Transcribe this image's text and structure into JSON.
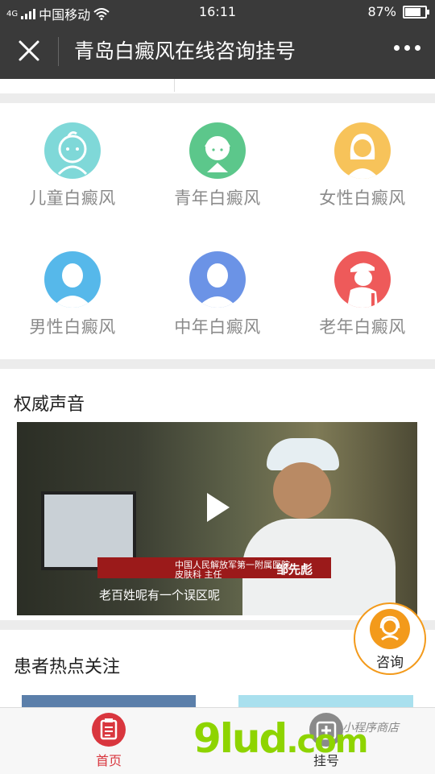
{
  "status_bar": {
    "carrier": "中国移动",
    "network": "4G",
    "time": "16:11",
    "battery_percent_text": "87%",
    "battery_level": 0.87
  },
  "title_bar": {
    "title": "青岛白癜风在线咨询挂号",
    "close_icon": "close-icon",
    "more_icon": "more-icon"
  },
  "categories": [
    {
      "label": "儿童白癜风",
      "icon": "child-icon",
      "color": "#7fd8d8"
    },
    {
      "label": "青年白癜风",
      "icon": "youth-icon",
      "color": "#5cc78b"
    },
    {
      "label": "女性白癜风",
      "icon": "woman-icon",
      "color": "#f7c35a"
    },
    {
      "label": "男性白癜风",
      "icon": "man-icon",
      "color": "#56b8ea"
    },
    {
      "label": "中年白癜风",
      "icon": "middle-aged-icon",
      "color": "#6b93e6"
    },
    {
      "label": "老年白癜风",
      "icon": "elderly-icon",
      "color": "#ee5a5a"
    }
  ],
  "authority": {
    "title": "权威声音",
    "video": {
      "subtitle_text": "老百姓呢有一个误区呢",
      "caption_org": "中国人民解放军第一附属医院",
      "caption_dept": "皮肤科 主任",
      "caption_name": "邹先彪",
      "play_icon": "play-icon"
    }
  },
  "hot_topics": {
    "title": "患者热点关注"
  },
  "consult_button": {
    "label": "咨询",
    "icon": "consult-icon"
  },
  "tab_bar": {
    "items": [
      {
        "label": "首页",
        "icon": "home-icon",
        "active": true
      },
      {
        "label": "挂号",
        "icon": "register-icon",
        "active": false
      }
    ]
  },
  "watermark": {
    "brand": "9lud",
    "suffix": ".com",
    "tagline": "小程序商店"
  },
  "colors": {
    "header": "#3a3a3a",
    "accent_red": "#d9363e",
    "consult_orange": "#f39a1b"
  }
}
